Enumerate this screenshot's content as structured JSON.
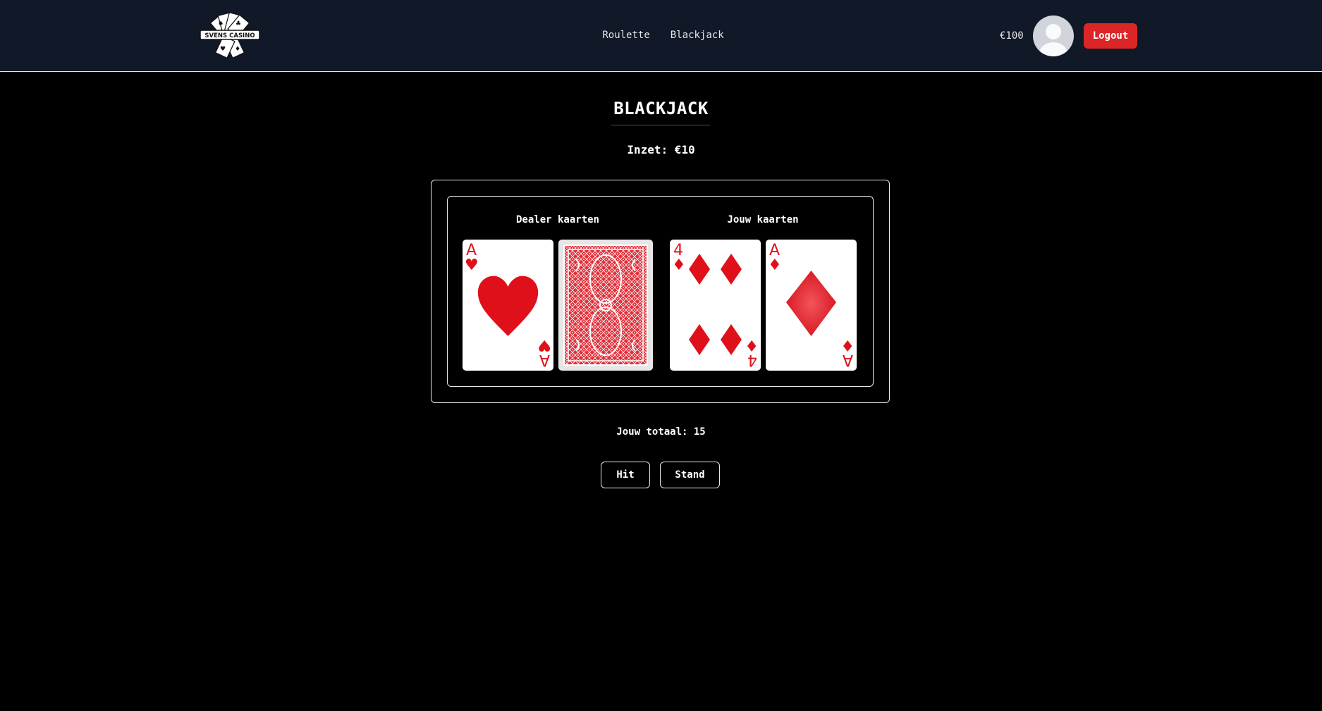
{
  "header": {
    "logo_text": "SVENS CASINO",
    "nav": [
      {
        "label": "Roulette"
      },
      {
        "label": "Blackjack"
      }
    ],
    "balance": "€100",
    "logout_label": "Logout"
  },
  "game": {
    "title": "BLACKJACK",
    "bet_text": "Inzet: €10",
    "dealer_label": "Dealer kaarten",
    "player_label": "Jouw kaarten",
    "dealer_cards": [
      {
        "rank": "A",
        "suit": "hearts",
        "suit_symbol": "♥",
        "face_up": true
      },
      {
        "face_up": false
      }
    ],
    "player_cards": [
      {
        "rank": "4",
        "suit": "diamonds",
        "suit_symbol": "♦",
        "face_up": true
      },
      {
        "rank": "A",
        "suit": "diamonds",
        "suit_symbol": "♦",
        "face_up": true
      }
    ],
    "total_text": "Jouw totaal: 15",
    "hit_label": "Hit",
    "stand_label": "Stand"
  },
  "colors": {
    "navbar_bg": "#111827",
    "logout_bg": "#dc2626",
    "card_red": "#e0101a"
  }
}
